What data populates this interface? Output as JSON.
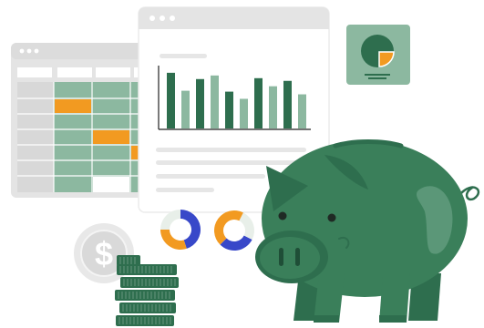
{
  "colors": {
    "green_dark": "#2e6e4e",
    "green_mid": "#3a7f5a",
    "green_light": "#8cb8a0",
    "green_pale": "#b9d3c4",
    "orange": "#f29a21",
    "blue": "#3848c9",
    "gray_frame": "#e4e4e4",
    "gray_line": "#e6e6e6",
    "coin_gray": "#e6e6e6"
  },
  "icons": [
    "spreadsheet-window",
    "bar-chart-window",
    "pie-chart-card",
    "donut-chart",
    "dollar-coin",
    "coin-stack",
    "piggy-bank"
  ],
  "chart_data": {
    "type": "bar",
    "categories": [
      "",
      "",
      "",
      "",
      "",
      "",
      "",
      "",
      "",
      "",
      "",
      ""
    ],
    "values": [
      62,
      42,
      55,
      59,
      41,
      33,
      56,
      47,
      53,
      38
    ],
    "ylim": [
      0,
      70
    ]
  },
  "donuts": [
    {
      "segments": [
        0.45,
        0.3,
        0.25
      ]
    },
    {
      "segments": [
        0.3,
        0.45,
        0.25
      ]
    }
  ],
  "pie_card": {
    "highlight_fraction": 0.25
  }
}
